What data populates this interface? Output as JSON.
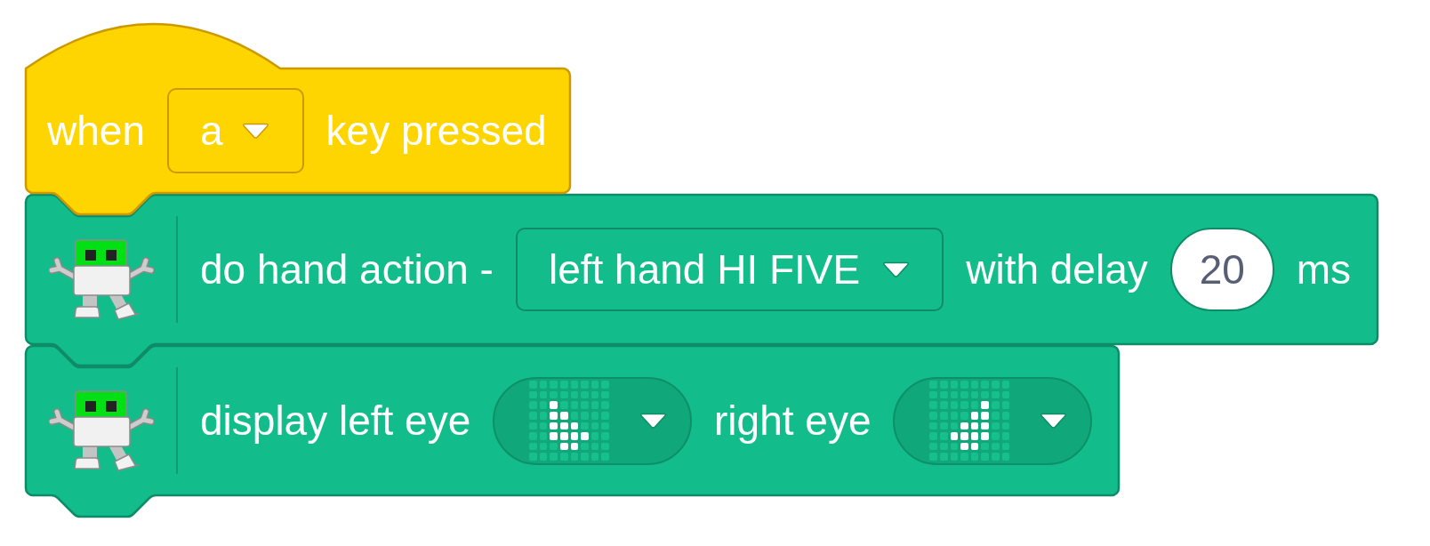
{
  "blocks": [
    {
      "kind": "hat",
      "parts": [
        {
          "kind": "label",
          "text": "when"
        },
        {
          "kind": "dropdown",
          "value": "a"
        },
        {
          "kind": "label",
          "text": "key pressed"
        }
      ]
    },
    {
      "kind": "command",
      "parts": [
        {
          "kind": "label",
          "text": "do hand action -"
        },
        {
          "kind": "dropdown",
          "value": "left hand HI FIVE"
        },
        {
          "kind": "label",
          "text": "with delay"
        },
        {
          "kind": "number",
          "value": "20"
        },
        {
          "kind": "label",
          "text": "ms"
        }
      ]
    },
    {
      "kind": "command",
      "parts": [
        {
          "kind": "label",
          "text": "display left eye"
        },
        {
          "kind": "matrix",
          "pixels": [
            [
              false,
              false,
              false,
              false,
              false,
              false,
              false,
              false
            ],
            [
              false,
              false,
              false,
              false,
              false,
              false,
              false,
              false
            ],
            [
              false,
              false,
              true,
              false,
              false,
              false,
              false,
              false
            ],
            [
              false,
              false,
              true,
              true,
              false,
              false,
              false,
              false
            ],
            [
              false,
              false,
              true,
              true,
              true,
              false,
              false,
              false
            ],
            [
              false,
              false,
              true,
              true,
              true,
              true,
              false,
              false
            ],
            [
              false,
              false,
              false,
              true,
              true,
              false,
              false,
              false
            ],
            [
              false,
              false,
              false,
              false,
              false,
              false,
              false,
              false
            ]
          ]
        },
        {
          "kind": "label",
          "text": "right eye"
        },
        {
          "kind": "matrix",
          "pixels": [
            [
              false,
              false,
              false,
              false,
              false,
              false,
              false,
              false
            ],
            [
              false,
              false,
              false,
              false,
              false,
              false,
              false,
              false
            ],
            [
              false,
              false,
              false,
              false,
              false,
              true,
              false,
              false
            ],
            [
              false,
              false,
              false,
              false,
              true,
              true,
              false,
              false
            ],
            [
              false,
              false,
              false,
              true,
              true,
              true,
              false,
              false
            ],
            [
              false,
              false,
              true,
              true,
              true,
              true,
              false,
              false
            ],
            [
              false,
              false,
              false,
              true,
              true,
              false,
              false,
              false
            ],
            [
              false,
              false,
              false,
              false,
              false,
              false,
              false,
              false
            ]
          ]
        }
      ]
    }
  ]
}
